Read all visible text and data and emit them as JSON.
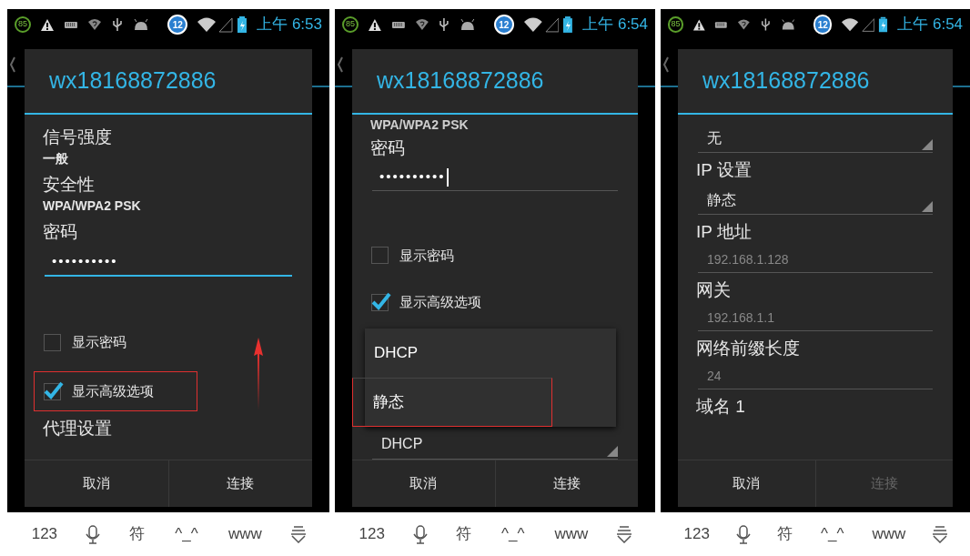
{
  "panels": [
    {
      "status_bar": {
        "badge": "85",
        "notification_count": "12",
        "time": "上午 6:53"
      },
      "dialog": {
        "title": "wx18168872886",
        "items": [
          {
            "kind": "info",
            "label": "信号强度",
            "value": "一般"
          },
          {
            "kind": "info",
            "label": "安全性",
            "value": "WPA/WPA2 PSK"
          },
          {
            "kind": "label",
            "label": "密码"
          },
          {
            "kind": "password",
            "value": "••••••••••",
            "focused": true
          },
          {
            "kind": "checkbox",
            "label": "显示密码",
            "checked": false,
            "highlighted": false
          },
          {
            "kind": "checkbox",
            "label": "显示高级选项",
            "checked": true,
            "highlighted": true
          },
          {
            "kind": "label",
            "label": "代理设置"
          }
        ],
        "arrow": true,
        "buttons": [
          {
            "label": "取消",
            "disabled": false
          },
          {
            "label": "连接",
            "disabled": false
          }
        ]
      },
      "keyboard": [
        {
          "kind": "text",
          "label": "123"
        },
        {
          "kind": "mic"
        },
        {
          "kind": "text",
          "label": "符"
        },
        {
          "kind": "text",
          "label": "^_^"
        },
        {
          "kind": "text",
          "label": "www"
        },
        {
          "kind": "hide"
        }
      ]
    },
    {
      "status_bar": {
        "badge": "85",
        "notification_count": "12",
        "time": "上午 6:54"
      },
      "dialog": {
        "title": "wx18168872886",
        "items": [
          {
            "kind": "value",
            "value": "WPA/WPA2 PSK"
          },
          {
            "kind": "label",
            "label": "密码"
          },
          {
            "kind": "password",
            "value": "••••••••••",
            "focused": false
          },
          {
            "kind": "checkbox",
            "label": "显示密码",
            "checked": false,
            "highlighted": false
          },
          {
            "kind": "checkbox",
            "label": "显示高级选项",
            "checked": true,
            "highlighted": false
          },
          {
            "kind": "popup",
            "options": [
              {
                "label": "DHCP",
                "highlighted": false
              },
              {
                "label": "静态",
                "highlighted": true
              }
            ]
          },
          {
            "kind": "spinner",
            "value": "DHCP"
          }
        ],
        "arrow": false,
        "buttons": [
          {
            "label": "取消",
            "disabled": false
          },
          {
            "label": "连接",
            "disabled": false
          }
        ]
      },
      "keyboard": [
        {
          "kind": "text",
          "label": "123"
        },
        {
          "kind": "mic"
        },
        {
          "kind": "text",
          "label": "符"
        },
        {
          "kind": "text",
          "label": "^_^"
        },
        {
          "kind": "text",
          "label": "www"
        },
        {
          "kind": "hide"
        }
      ]
    },
    {
      "status_bar": {
        "badge": "85",
        "notification_count": "12",
        "time": "上午 6:54"
      },
      "dialog": {
        "title": "wx18168872886",
        "items": [
          {
            "kind": "spinner",
            "value": "无"
          },
          {
            "kind": "label",
            "label": "IP 设置"
          },
          {
            "kind": "spinner",
            "value": "静态"
          },
          {
            "kind": "label",
            "label": "IP 地址"
          },
          {
            "kind": "input",
            "placeholder": "192.168.1.128"
          },
          {
            "kind": "label",
            "label": "网关"
          },
          {
            "kind": "input",
            "placeholder": "192.168.1.1"
          },
          {
            "kind": "label",
            "label": "网络前缀长度"
          },
          {
            "kind": "input",
            "placeholder": "24"
          },
          {
            "kind": "label",
            "label": "域名 1"
          }
        ],
        "arrow": false,
        "buttons": [
          {
            "label": "取消",
            "disabled": false
          },
          {
            "label": "连接",
            "disabled": true
          }
        ]
      },
      "keyboard": [
        {
          "kind": "text",
          "label": "123"
        },
        {
          "kind": "mic"
        },
        {
          "kind": "text",
          "label": "符"
        },
        {
          "kind": "text",
          "label": "^_^"
        },
        {
          "kind": "text",
          "label": "www"
        },
        {
          "kind": "hide"
        }
      ]
    }
  ]
}
